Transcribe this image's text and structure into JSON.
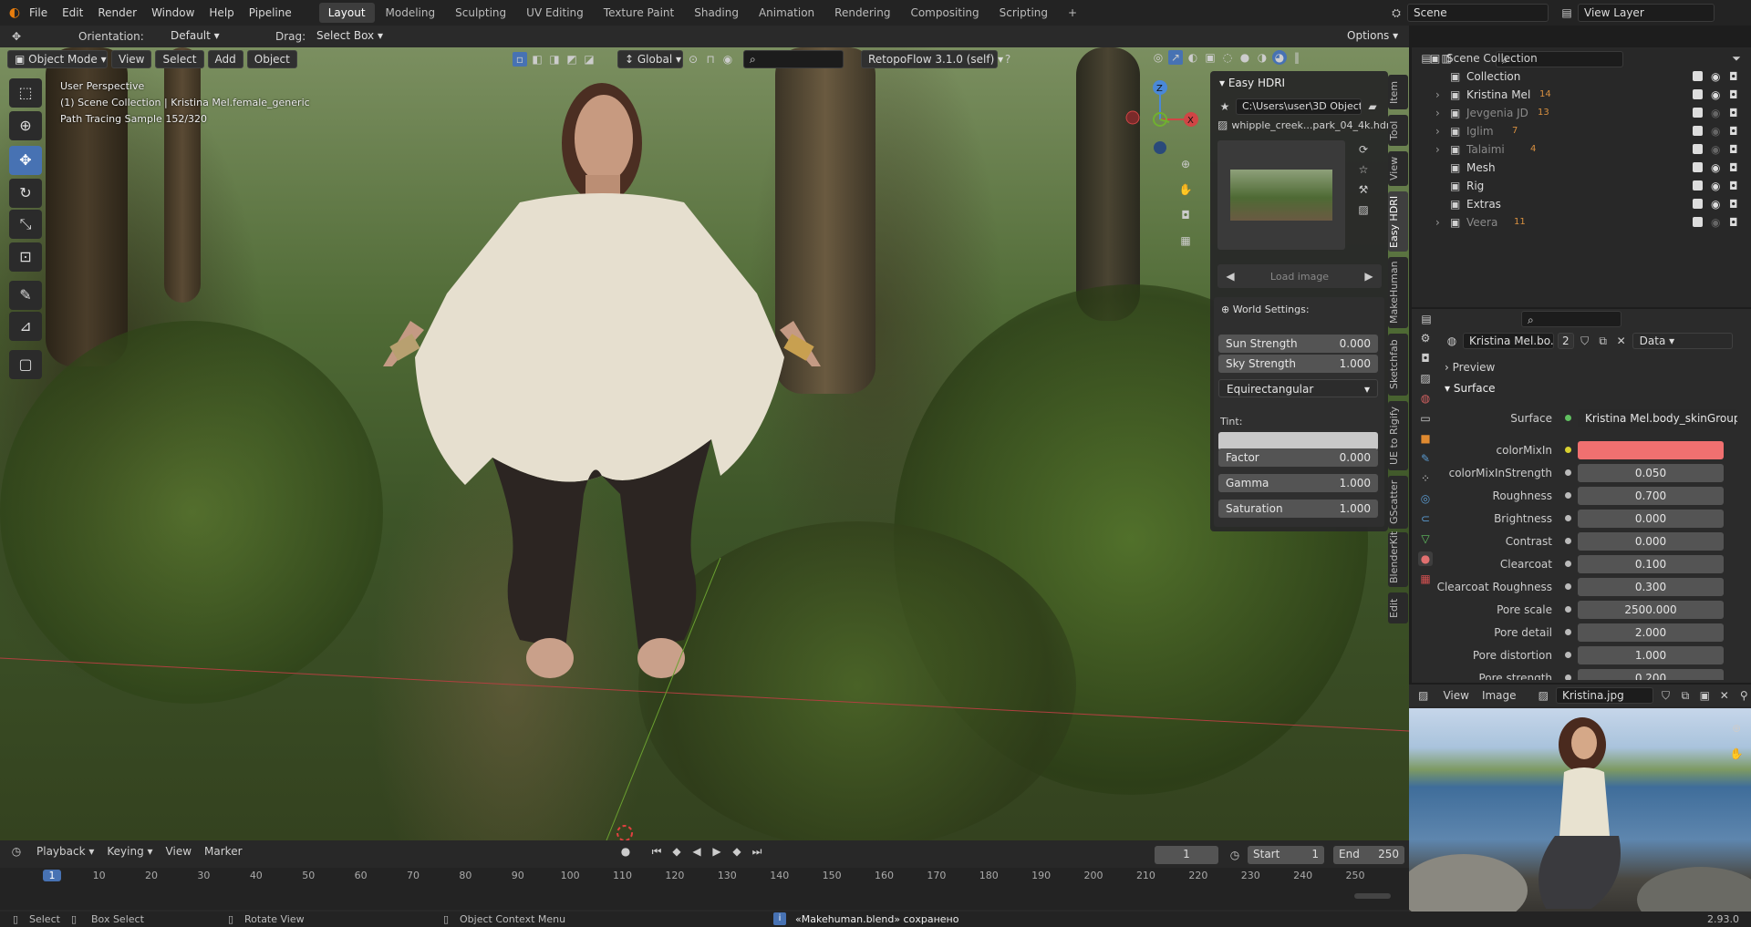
{
  "app": {
    "logo": "blender-logo-icon",
    "version": "2.93.0"
  },
  "menubar": {
    "items": [
      "File",
      "Edit",
      "Render",
      "Window",
      "Help",
      "Pipeline"
    ],
    "workspaces": [
      "Layout",
      "Modeling",
      "Sculpting",
      "UV Editing",
      "Texture Paint",
      "Shading",
      "Animation",
      "Rendering",
      "Compositing",
      "Scripting"
    ],
    "active_workspace": "Layout",
    "scene": "Scene",
    "view_layer": "View Layer"
  },
  "tool_header": {
    "orientation_label": "Orientation:",
    "orientation_value": "Default",
    "drag_label": "Drag:",
    "drag_value": "Select Box",
    "options": "Options"
  },
  "viewport_header": {
    "mode": "Object Mode",
    "menus": [
      "View",
      "Select",
      "Add",
      "Object"
    ],
    "transform_orientation": "Global",
    "addon": "RetopoFlow 3.1.0 (self)"
  },
  "viewport": {
    "perspective": "User Perspective",
    "collection_info": "(1) Scene Collection | Kristina Mel.female_generic",
    "render_status": "Path Tracing Sample 152/320",
    "gizmo": {
      "x": "X",
      "y": "Y",
      "z": "Z"
    }
  },
  "easy_hdri": {
    "title": "Easy HDRI",
    "folder": "C:\\Users\\user\\3D Objects...",
    "file": "whipple_creek...park_04_4k.hdr",
    "load_image": "Load image",
    "world_settings": "World Settings:",
    "sun_strength": {
      "label": "Sun Strength",
      "value": "0.000"
    },
    "sky_strength": {
      "label": "Sky Strength",
      "value": "1.000"
    },
    "projection": "Equirectangular",
    "tint_label": "Tint:",
    "factor": {
      "label": "Factor",
      "value": "0.000"
    },
    "gamma": {
      "label": "Gamma",
      "value": "1.000"
    },
    "saturation": {
      "label": "Saturation",
      "value": "1.000"
    }
  },
  "sidebar_tabs": [
    "Item",
    "Tool",
    "View",
    "Easy HDRI",
    "MakeHuman",
    "Sketchfab",
    "UE to Rigify",
    "GScatter",
    "BlenderKit",
    "Edit"
  ],
  "outliner": {
    "root": "Scene Collection",
    "items": [
      {
        "name": "Collection",
        "count": ""
      },
      {
        "name": "Kristina Mel",
        "count": "14"
      },
      {
        "name": "Jevgenia JD",
        "count": "13"
      },
      {
        "name": "Iglim",
        "count": "7"
      },
      {
        "name": "Talaimi",
        "count": "4"
      },
      {
        "name": "Mesh",
        "count": ""
      },
      {
        "name": "Rig",
        "count": ""
      },
      {
        "name": "Extras",
        "count": ""
      },
      {
        "name": "Veera",
        "count": "11"
      }
    ]
  },
  "properties": {
    "datablock": "Kristina Mel.bo...",
    "users": "2",
    "data_dropdown": "Data",
    "preview": "Preview",
    "surface_section": "Surface",
    "surface_label": "Surface",
    "surface_value": "Kristina Mel.body_skinGroup.0...",
    "color_mix_label": "colorMixIn",
    "color_mix_color": "#f07070",
    "rows": [
      {
        "label": "colorMixInStrength",
        "value": "0.050"
      },
      {
        "label": "Roughness",
        "value": "0.700"
      },
      {
        "label": "Brightness",
        "value": "0.000"
      },
      {
        "label": "Contrast",
        "value": "0.000"
      },
      {
        "label": "Clearcoat",
        "value": "0.100"
      },
      {
        "label": "Clearcoat Roughness",
        "value": "0.300"
      },
      {
        "label": "Pore scale",
        "value": "2500.000"
      },
      {
        "label": "Pore detail",
        "value": "2.000"
      },
      {
        "label": "Pore distortion",
        "value": "1.000"
      },
      {
        "label": "Pore strength",
        "value": "0.200"
      }
    ]
  },
  "image_editor": {
    "menus": [
      "View",
      "Image"
    ],
    "image_name": "Kristina.jpg"
  },
  "timeline": {
    "menus": [
      "Playback",
      "Keying",
      "View",
      "Marker"
    ],
    "current_frame": "1",
    "start_label": "Start",
    "start": "1",
    "end_label": "End",
    "end": "250",
    "ticks": [
      "1",
      "10",
      "20",
      "30",
      "40",
      "50",
      "60",
      "70",
      "80",
      "90",
      "100",
      "110",
      "120",
      "130",
      "140",
      "150",
      "160",
      "170",
      "180",
      "190",
      "200",
      "210",
      "220",
      "230",
      "240",
      "250"
    ]
  },
  "statusbar": {
    "select": "Select",
    "box_select": "Box Select",
    "rotate_view": "Rotate View",
    "context_menu": "Object Context Menu",
    "message": "«Makehuman.blend» сохранено"
  },
  "colors": {
    "accent": "#4772b3",
    "bg": "#1d1d1d",
    "panel": "#2b2b2b"
  }
}
